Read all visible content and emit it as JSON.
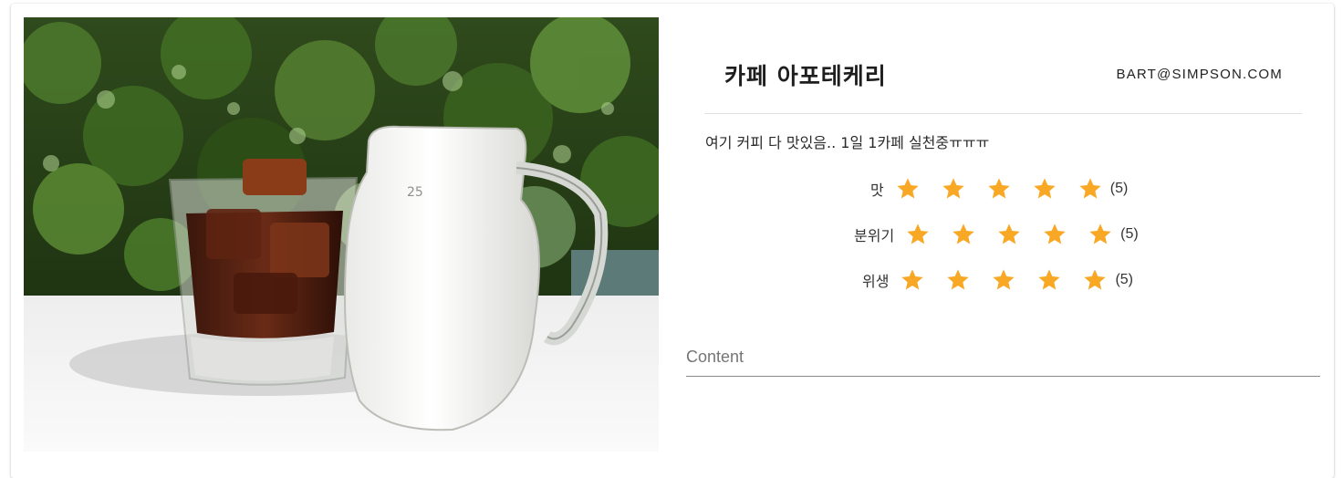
{
  "post": {
    "title": "카페 아포테케리",
    "email": "BART@SIMPSON.COM",
    "description": "여기 커피 다 맛있음.. 1일 1카페 실천중ㅠㅠㅠ"
  },
  "photo": {
    "glass_marking": "25"
  },
  "ratings": [
    {
      "label": "맛",
      "value": 5,
      "max": 5,
      "count_text": "(5)"
    },
    {
      "label": "분위기",
      "value": 5,
      "max": 5,
      "count_text": "(5)"
    },
    {
      "label": "위생",
      "value": 5,
      "max": 5,
      "count_text": "(5)"
    }
  ],
  "comment_field": {
    "label": "Content",
    "value": ""
  },
  "colors": {
    "star": "#f9a825",
    "divider": "#e2e2e2",
    "underline": "#8a8a8a"
  },
  "icons": {
    "star": "star-icon"
  }
}
